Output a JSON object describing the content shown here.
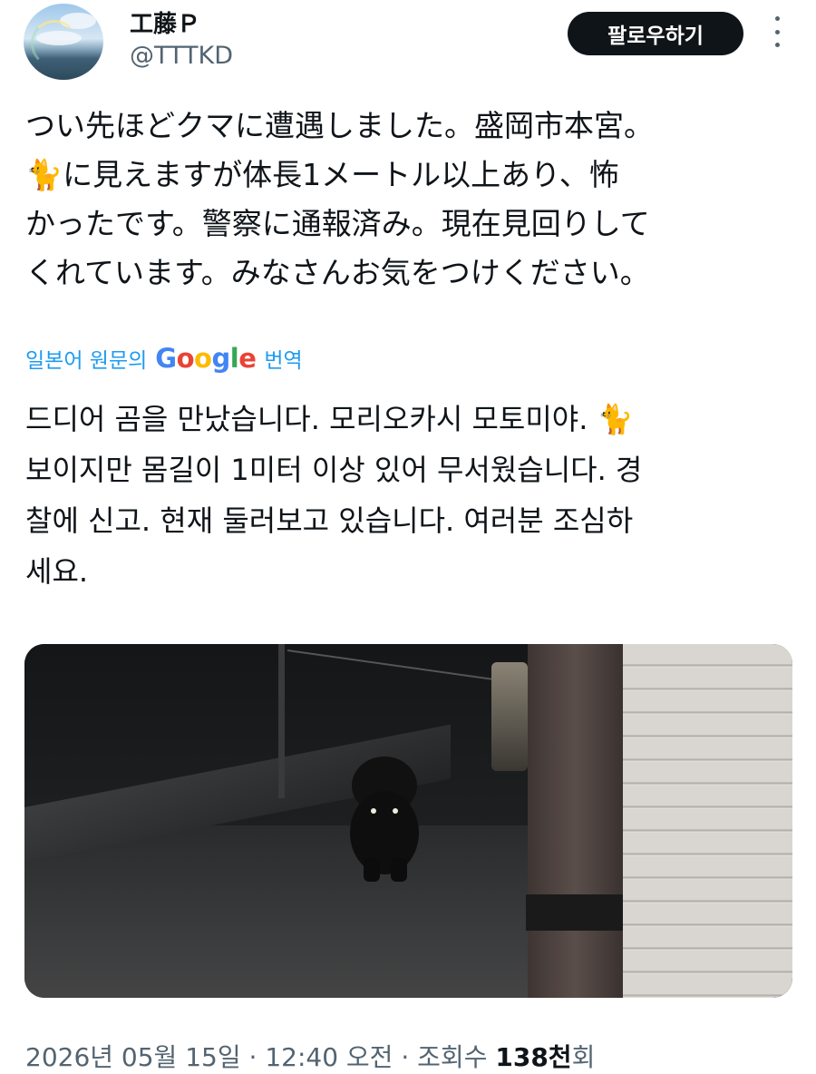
{
  "header": {
    "display_name": "工藤Ｐ",
    "handle": "@TTTKD",
    "follow_label": "팔로우하기"
  },
  "tweet": {
    "text": "つい先ほどクマに遭遇しました。盛岡市本宮。\n🐈に見えますが体長1メートル以上あり、怖\nかったです。警察に通報済み。現在見回りして\nくれています。みなさんお気をつけください。",
    "translate_prefix": "일본어 원문의",
    "translate_brand": "Google",
    "translate_suffix": "번역",
    "translated_text": "드디어 곰을 만났습니다. 모리오카시 모토미야. 🐈\n보이지만 몸길이 1미터 이상 있어 무서웠습니다. 경\n찰에 신고. 현재 둘러보고 있습니다. 여러분 조심하\n세요."
  },
  "media": {
    "icon": "photo-bear-at-night"
  },
  "meta": {
    "date": "2026년 05월 15일",
    "time": "12:40 오전",
    "views_label": "조회수",
    "views_count": "138천",
    "views_unit": "회",
    "separator": "·"
  }
}
